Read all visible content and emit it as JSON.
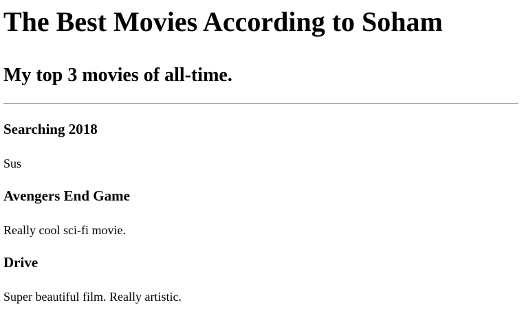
{
  "header": {
    "title": "The Best Movies According to Soham",
    "subtitle": "My top 3 movies of all-time."
  },
  "movies": [
    {
      "title": "Searching 2018",
      "description": "Sus"
    },
    {
      "title": "Avengers End Game",
      "description": "Really cool sci-fi movie."
    },
    {
      "title": "Drive",
      "description": "Super beautiful film. Really artistic."
    }
  ]
}
